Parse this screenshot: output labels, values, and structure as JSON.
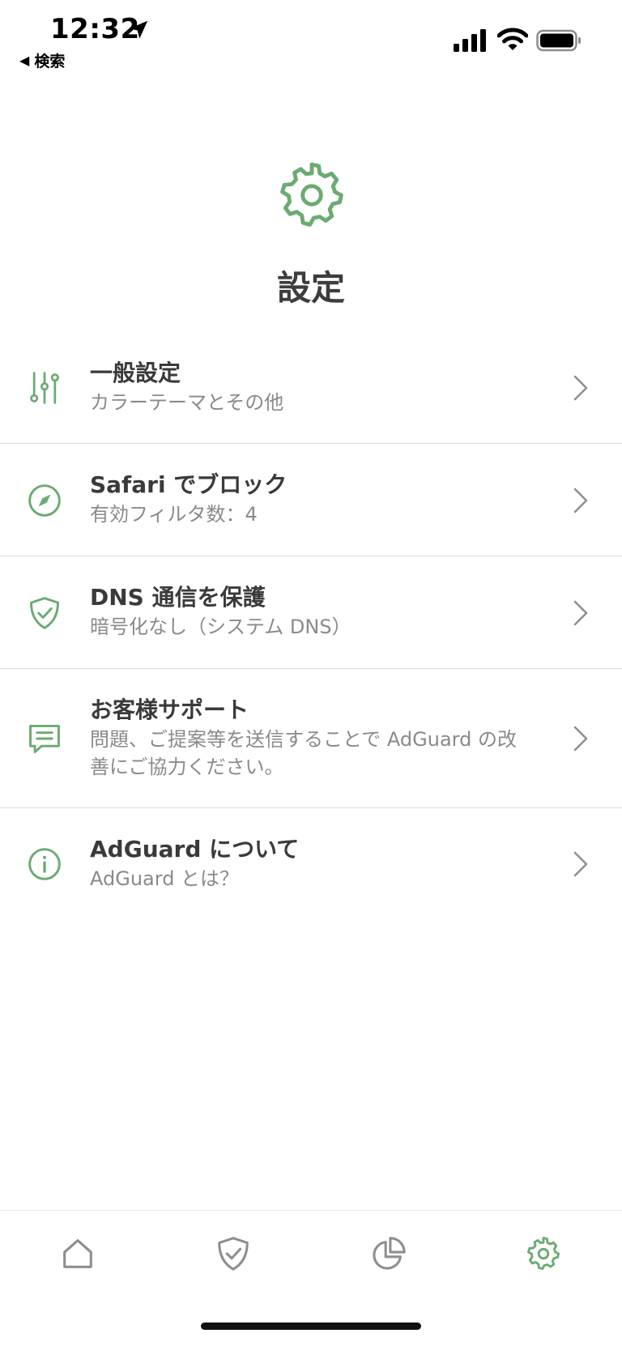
{
  "status_bar": {
    "time": "12:32",
    "back_app": "検索",
    "back_glyph": "◀"
  },
  "header": {
    "title": "設定",
    "icon": "gear-icon"
  },
  "settings_items": [
    {
      "title": "一般設定",
      "subtitle": "カラーテーマとその他",
      "icon": "sliders-icon"
    },
    {
      "title": "Safari でブロック",
      "subtitle": "有効フィルタ数：4",
      "icon": "compass-icon"
    },
    {
      "title": "DNS 通信を保護",
      "subtitle": "暗号化なし（システム DNS）",
      "icon": "shield-check-icon"
    },
    {
      "title": "お客様サポート",
      "subtitle": "問題、ご提案等を送信することで AdGuard の改善にご協力ください。",
      "icon": "chat-icon"
    },
    {
      "title": "AdGuard について",
      "subtitle": "AdGuard とは？",
      "icon": "info-icon"
    }
  ],
  "tab_bar": {
    "tabs": [
      {
        "icon": "home-icon",
        "active": false
      },
      {
        "icon": "shield-check-icon",
        "active": false
      },
      {
        "icon": "pie-chart-icon",
        "active": false
      },
      {
        "icon": "gear-icon",
        "active": true
      }
    ]
  },
  "colors": {
    "accent": "#6bab72",
    "text_primary": "#3a3a3a",
    "text_secondary": "#8a8a8a",
    "inactive_icon": "#8e8e8e",
    "divider": "#dcdcdc"
  }
}
